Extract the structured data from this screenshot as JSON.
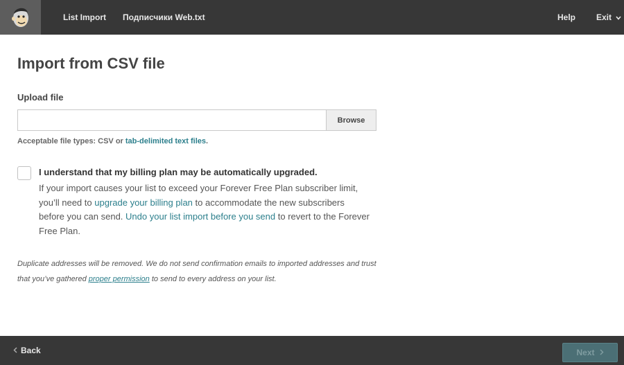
{
  "topbar": {
    "logo_icon": "mailchimp-freddie-logo",
    "nav_list_import": "List Import",
    "nav_filename": "Подписчики Web.txt",
    "nav_help": "Help",
    "nav_exit": "Exit",
    "exit_icon": "chevron-down-icon",
    "bg_color": "#373737"
  },
  "main": {
    "title": "Import from CSV file",
    "upload_label": "Upload file",
    "file_input_value": "",
    "browse_label": "Browse",
    "file_types_prefix": "Acceptable file types: CSV or",
    "file_types_link": "tab-delimited text files",
    "file_types_suffix": ".",
    "billing_checkbox_checked": false,
    "billing_title": "I understand that my billing plan may be automatically upgraded.",
    "billing_text_1": "If your import causes your list to exceed your Forever Free Plan subscriber limit, you’ll need to",
    "billing_link_1": "upgrade your billing plan",
    "billing_text_2": "to accommodate the new subscribers before you can send.",
    "billing_link_2": "Undo your list import before you send",
    "billing_text_3": "to revert to the Forever Free Plan.",
    "note_text_1": "Duplicate addresses will be removed. We do not send confirmation emails to imported addresses and trust that you’ve gathered",
    "note_link": "proper permission",
    "note_text_2": "to send to every address on your list.",
    "link_color": "#2c7f8c"
  },
  "footer": {
    "back_label": "Back",
    "back_icon": "chevron-left-icon",
    "next_label": "Next",
    "next_icon": "chevron-right-icon",
    "next_disabled": true
  }
}
